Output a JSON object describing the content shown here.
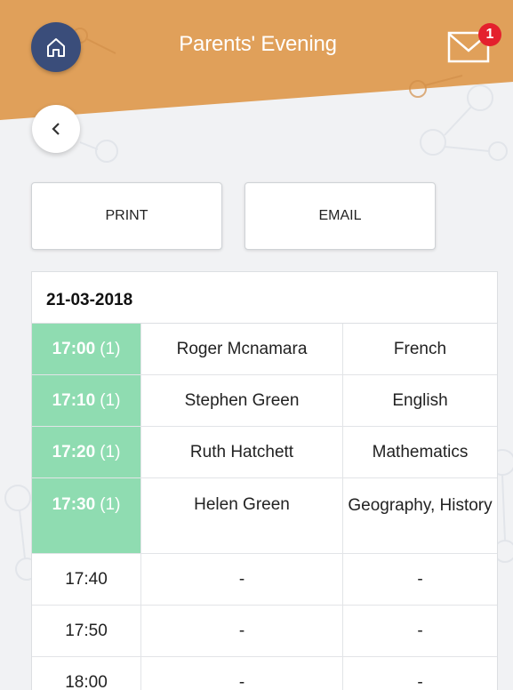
{
  "header": {
    "title": "Parents' Evening",
    "mail_badge_count": "1",
    "banner_color": "#e0a05a",
    "home_button_color": "#3a4d7a"
  },
  "actions": {
    "print_label": "PRINT",
    "email_label": "EMAIL"
  },
  "schedule": {
    "date": "21-03-2018",
    "booked_color": "#8fdcb1",
    "slots": [
      {
        "time": "17:00",
        "count": "(1)",
        "teacher": "Roger Mcnamara",
        "subject": "French",
        "booked": true
      },
      {
        "time": "17:10",
        "count": "(1)",
        "teacher": "Stephen Green",
        "subject": "English",
        "booked": true
      },
      {
        "time": "17:20",
        "count": "(1)",
        "teacher": "Ruth Hatchett",
        "subject": "Mathematics",
        "booked": true
      },
      {
        "time": "17:30",
        "count": "(1)",
        "teacher": "Helen Green",
        "subject": "Geography, History",
        "booked": true
      },
      {
        "time": "17:40",
        "count": "",
        "teacher": "-",
        "subject": "-",
        "booked": false
      },
      {
        "time": "17:50",
        "count": "",
        "teacher": "-",
        "subject": "-",
        "booked": false
      },
      {
        "time": "18:00",
        "count": "",
        "teacher": "-",
        "subject": "-",
        "booked": false
      }
    ]
  },
  "icons": {
    "home": "home-icon",
    "mail": "envelope-icon",
    "back": "chevron-left-icon"
  }
}
